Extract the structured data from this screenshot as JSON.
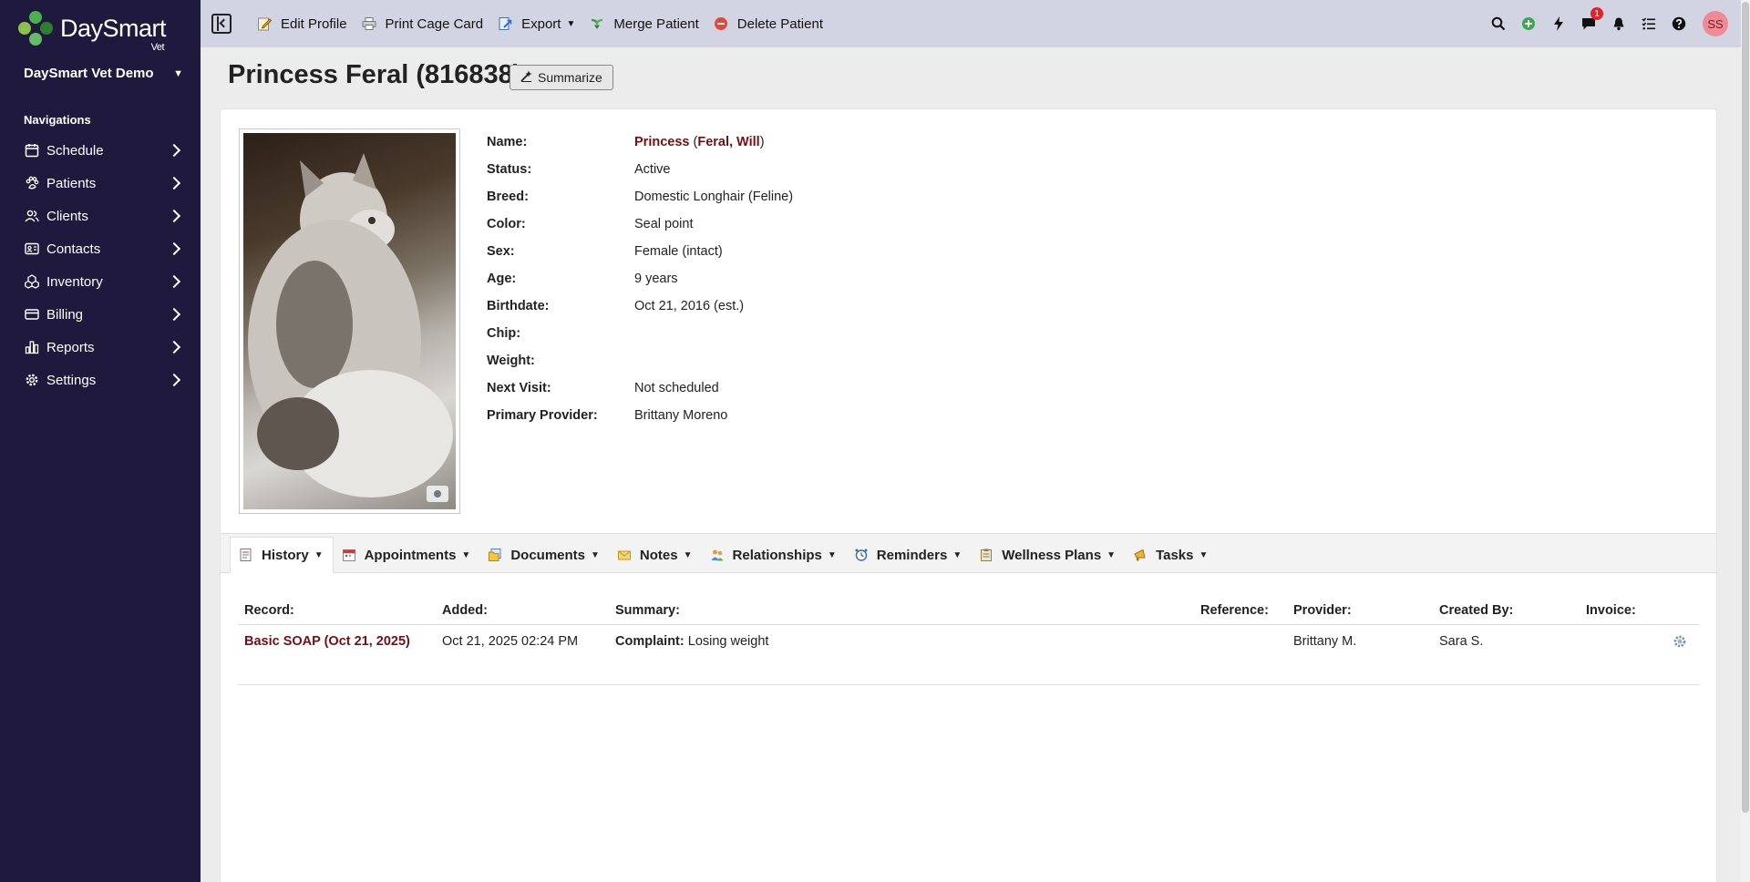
{
  "sidebar": {
    "brand": "DaySmart",
    "brand_sub": "Vet",
    "org": "DaySmart Vet Demo",
    "nav_heading": "Navigations",
    "items": [
      {
        "label": "Schedule",
        "icon": "calendar-icon"
      },
      {
        "label": "Patients",
        "icon": "paw-icon"
      },
      {
        "label": "Clients",
        "icon": "users-icon"
      },
      {
        "label": "Contacts",
        "icon": "contact-card-icon"
      },
      {
        "label": "Inventory",
        "icon": "boxes-icon"
      },
      {
        "label": "Billing",
        "icon": "credit-card-icon"
      },
      {
        "label": "Reports",
        "icon": "bar-chart-icon"
      },
      {
        "label": "Settings",
        "icon": "gear-icon"
      }
    ]
  },
  "toolbar": {
    "edit_profile": "Edit Profile",
    "print_cage_card": "Print Cage Card",
    "export": "Export",
    "merge_patient": "Merge Patient",
    "delete_patient": "Delete Patient",
    "chat_badge": "1",
    "avatar_initials": "SS"
  },
  "page": {
    "title": "Princess Feral (816838)",
    "summarize_label": "Summarize"
  },
  "patient": {
    "fields": {
      "name_label": "Name:",
      "status_label": "Status:",
      "breed_label": "Breed:",
      "color_label": "Color:",
      "sex_label": "Sex:",
      "age_label": "Age:",
      "birthdate_label": "Birthdate:",
      "chip_label": "Chip:",
      "weight_label": "Weight:",
      "next_visit_label": "Next Visit:",
      "primary_provider_label": "Primary Provider:"
    },
    "name_first": "Princess",
    "owner": "Feral, Will",
    "status": "Active",
    "breed": "Domestic Longhair (Feline)",
    "color": "Seal point",
    "sex": "Female (intact)",
    "age": "9 years",
    "birthdate": "Oct 21, 2016 (est.)",
    "chip": "",
    "weight": "",
    "next_visit": "Not scheduled",
    "primary_provider": "Brittany Moreno"
  },
  "tabs": [
    {
      "label": "History",
      "icon": "history-icon"
    },
    {
      "label": "Appointments",
      "icon": "calendar-icon"
    },
    {
      "label": "Documents",
      "icon": "documents-icon"
    },
    {
      "label": "Notes",
      "icon": "note-icon"
    },
    {
      "label": "Relationships",
      "icon": "people-icon"
    },
    {
      "label": "Reminders",
      "icon": "alarm-clock-icon"
    },
    {
      "label": "Wellness Plans",
      "icon": "clipboard-icon"
    },
    {
      "label": "Tasks",
      "icon": "megaphone-icon"
    }
  ],
  "history": {
    "headers": {
      "record": "Record:",
      "added": "Added:",
      "summary": "Summary:",
      "reference": "Reference:",
      "provider": "Provider:",
      "created_by": "Created By:",
      "invoice": "Invoice:"
    },
    "rows": [
      {
        "record": "Basic SOAP (Oct 21, 2025)",
        "added": "Oct 21, 2025 02:24 PM",
        "summary_label": "Complaint:",
        "summary_value": "Losing weight",
        "reference": "",
        "provider": "Brittany M.",
        "created_by": "Sara S.",
        "invoice": ""
      }
    ]
  },
  "colors": {
    "sidebar_bg": "#1f1a3d",
    "topbar_bg": "#d2d4e4",
    "link": "#7a0d12",
    "badge": "#e0242b",
    "avatar": "#f08a95"
  }
}
